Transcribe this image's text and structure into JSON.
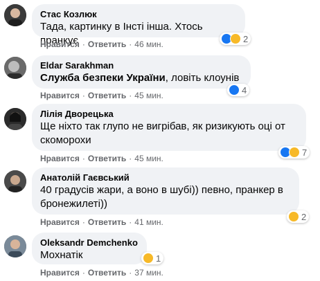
{
  "comments": [
    {
      "author": "Стас Козлюк",
      "text": "Тада, картинку в Інсті інша. Хтось пранкує",
      "bold_text": "",
      "reaction_count": "2",
      "like": "Нравится",
      "reply": "Ответить",
      "time": "46 мин."
    },
    {
      "author": "Eldar Sarakhman",
      "bold_text": "Служба безпеки України",
      "text": ", ловіть клоунів",
      "reaction_count": "4",
      "like": "Нравится",
      "reply": "Ответить",
      "time": "45 мин."
    },
    {
      "author": "Лілія Дворецька",
      "text": "Ще ніхто так глупо не вигрібав, як ризикують оці от скоморохи",
      "bold_text": "",
      "reaction_count": "7",
      "like": "Нравится",
      "reply": "Ответить",
      "time": "45 мин."
    },
    {
      "author": "Анатолій Гаєвський",
      "text": "40 градусів жари, а воно в шубі)) певно, пранкер в бронежилеті))",
      "bold_text": "",
      "reaction_count": "2",
      "like": "Нравится",
      "reply": "Ответить",
      "time": "41 мин."
    },
    {
      "author": "Oleksandr Demchenko",
      "text": "Мохнатік",
      "bold_text": "",
      "reaction_count": "1",
      "like": "Нравится",
      "reply": "Ответить",
      "time": "37 мин."
    }
  ],
  "icons": {
    "like": "like-reaction-icon",
    "haha": "haha-reaction-icon"
  },
  "colors": {
    "bubble": "#f0f2f5",
    "meta": "#65676b",
    "like": "#1877f2",
    "haha": "#f7b928"
  }
}
